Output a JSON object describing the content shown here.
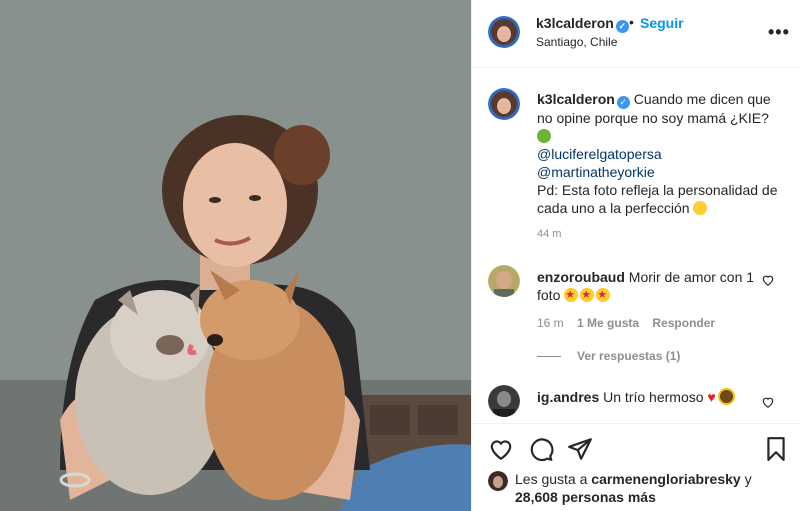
{
  "header": {
    "username": "k3lcalderon",
    "follow_label": "Seguir",
    "dot": "•",
    "location": "Santiago, Chile",
    "more_label": "•••"
  },
  "caption": {
    "username": "k3lcalderon",
    "text": "Cuando me dicen que no opine porque no soy mamá ¿KIE?",
    "mention1": "@luciferelgatopersa",
    "mention2": "@martinatheyorkie",
    "pd": "Pd: Esta foto refleja la personalidad de cada uno a la perfección",
    "time": "44 m"
  },
  "comments": [
    {
      "username": "enzoroubaud",
      "text": "Morir de amor con 1 foto",
      "time": "16 m",
      "likes": "1 Me gusta",
      "reply_label": "Responder",
      "view_replies": "Ver respuestas (1)"
    },
    {
      "username": "ig.andres",
      "text": "Un trío hermoso"
    }
  ],
  "likes": {
    "prefix": "Les gusta a",
    "user": "carmenengloriabresky",
    "conj": "y",
    "count": "28,608 personas más"
  },
  "icons": {
    "verified": "verified-badge-icon",
    "like": "heart-icon",
    "comment": "comment-icon",
    "share": "paper-plane-icon",
    "save": "bookmark-icon"
  },
  "colors": {
    "accent": "#0095f6",
    "verified": "#3897f0",
    "muted": "#8e8e8e",
    "link": "#00376b"
  }
}
